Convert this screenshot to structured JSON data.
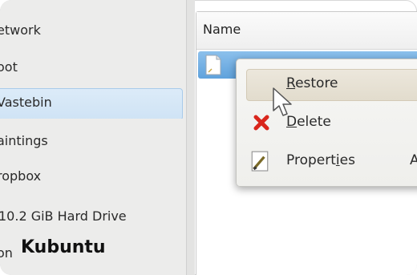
{
  "sidebar": {
    "items": [
      {
        "label": "etwork"
      },
      {
        "label": "oot"
      },
      {
        "label": "Vastebin"
      },
      {
        "label": "aintings"
      },
      {
        "label": "ropbox"
      },
      {
        "label": "10.2 GiB Hard Drive"
      },
      {
        "label": "on"
      }
    ]
  },
  "brand": {
    "label": "Kubuntu"
  },
  "fileview": {
    "column_header": "Name"
  },
  "context_menu": {
    "items": [
      {
        "pre": "",
        "u": "R",
        "post": "estore",
        "icon": "restore-blank-icon"
      },
      {
        "pre": "",
        "u": "D",
        "post": "elete",
        "icon": "delete-icon"
      },
      {
        "pre": "Propert",
        "u": "i",
        "post": "es",
        "icon": "properties-icon"
      }
    ],
    "extra": "A"
  },
  "colors": {
    "selection": "#cfe3f5",
    "accent_blue": "#5fa2dc",
    "menu_bg": "#f1f1ef",
    "delete_red": "#d9261c"
  }
}
